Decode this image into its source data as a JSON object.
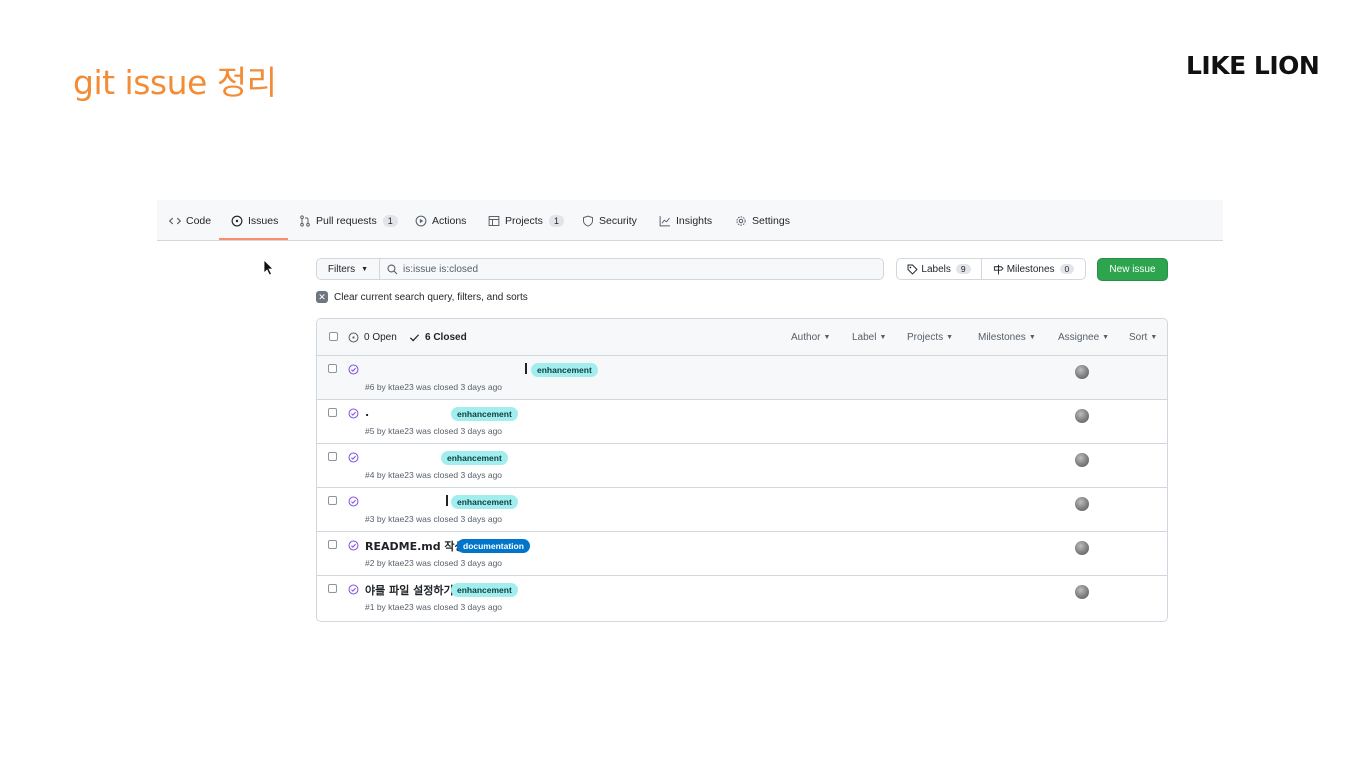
{
  "slide": {
    "title": "git issue 정리",
    "brand": "LIKE LION"
  },
  "nav": {
    "tabs": [
      {
        "label": "Code",
        "icon": "code-icon"
      },
      {
        "label": "Issues",
        "icon": "issue-opened-icon",
        "selected": true
      },
      {
        "label": "Pull requests",
        "icon": "pull-request-icon",
        "count": "1"
      },
      {
        "label": "Actions",
        "icon": "play-icon"
      },
      {
        "label": "Projects",
        "icon": "table-icon",
        "count": "1"
      },
      {
        "label": "Security",
        "icon": "shield-icon"
      },
      {
        "label": "Insights",
        "icon": "graph-icon"
      },
      {
        "label": "Settings",
        "icon": "gear-icon"
      }
    ]
  },
  "toolbar": {
    "filters_label": "Filters",
    "search_value": "is:issue is:closed",
    "labels_label": "Labels",
    "labels_count": "9",
    "milestones_label": "Milestones",
    "milestones_count": "0",
    "new_issue_label": "New issue",
    "clear_text": "Clear current search query, filters, and sorts"
  },
  "list_header": {
    "open_label": "0 Open",
    "closed_label": "6 Closed",
    "sort_options": [
      "Author",
      "Label",
      "Projects",
      "Milestones",
      "Assignee",
      "Sort"
    ]
  },
  "issues": [
    {
      "title": "",
      "label": "enhancement",
      "meta": "#6 by ktae23 was closed 3 days ago"
    },
    {
      "title": ".",
      "label": "enhancement",
      "meta": "#5 by ktae23 was closed 3 days ago"
    },
    {
      "title": "",
      "label": "enhancement",
      "meta": "#4 by ktae23 was closed 3 days ago"
    },
    {
      "title": "",
      "label": "enhancement",
      "meta": "#3 by ktae23 was closed 3 days ago"
    },
    {
      "title": "README.md 작성",
      "label": "documentation",
      "meta": "#2 by ktae23 was closed 3 days ago"
    },
    {
      "title": "야믈 파일 설정하기",
      "label": "enhancement",
      "meta": "#1 by ktae23 was closed 3 days ago"
    }
  ],
  "colors": {
    "accent_title": "#f28c36",
    "primary_button": "#2da44e",
    "tab_underline": "#fd8c73",
    "closed_icon": "#8250df",
    "enhancement_label": "#a2eeef",
    "documentation_label": "#0075ca"
  }
}
